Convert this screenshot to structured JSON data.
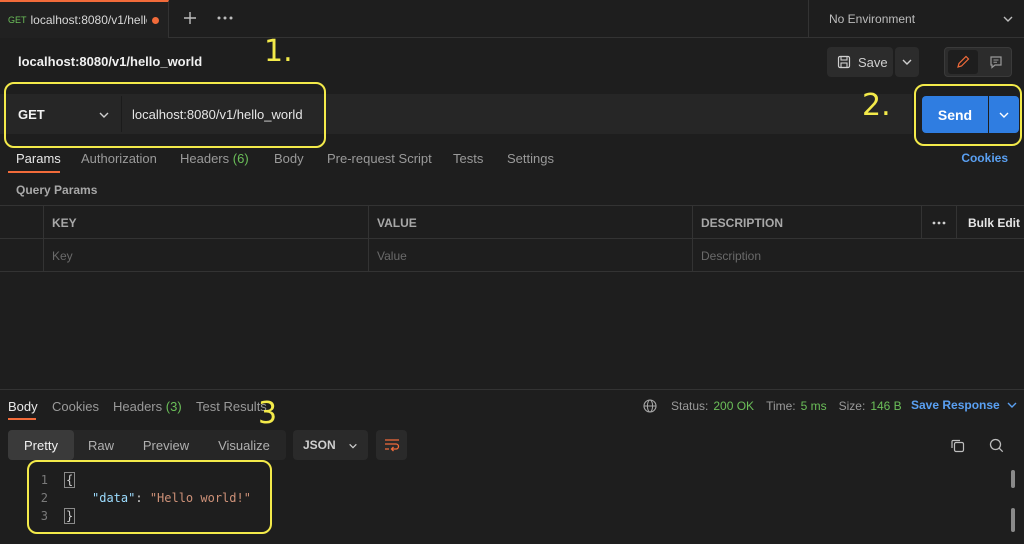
{
  "tab": {
    "method": "GET",
    "title": "localhost:8080/v1/hello"
  },
  "environment": {
    "label": "No Environment"
  },
  "request": {
    "title": "localhost:8080/v1/hello_world",
    "method": "GET",
    "url": "localhost:8080/v1/hello_world",
    "save_label": "Save",
    "send_label": "Send"
  },
  "request_tabs": {
    "params": "Params",
    "authorization": "Authorization",
    "headers": "Headers",
    "headers_count": "(6)",
    "body": "Body",
    "prerequest": "Pre-request Script",
    "tests": "Tests",
    "settings": "Settings",
    "cookies": "Cookies"
  },
  "query_params": {
    "title": "Query Params",
    "headers": {
      "key": "KEY",
      "value": "VALUE",
      "description": "DESCRIPTION"
    },
    "bulk_edit": "Bulk Edit",
    "placeholders": {
      "key": "Key",
      "value": "Value",
      "description": "Description"
    }
  },
  "response": {
    "tabs": {
      "body": "Body",
      "cookies": "Cookies",
      "headers": "Headers",
      "headers_count": "(3)",
      "test_results": "Test Results"
    },
    "status_label": "Status:",
    "status_value": "200 OK",
    "time_label": "Time:",
    "time_value": "5 ms",
    "size_label": "Size:",
    "size_value": "146 B",
    "save_response": "Save Response",
    "views": {
      "pretty": "Pretty",
      "raw": "Raw",
      "preview": "Preview",
      "visualize": "Visualize"
    },
    "format": "JSON",
    "lines": {
      "n1": "1",
      "n2": "2",
      "n3": "3",
      "l1": "{",
      "key": "\"data\"",
      "colon": ": ",
      "value": "\"Hello world!\"",
      "l3": "}"
    }
  },
  "annotations": {
    "one": "1.",
    "two": "2.",
    "three": "3"
  },
  "colors": {
    "accent": "#f26b3a",
    "send": "#2f7de1",
    "link": "#5aa0f2",
    "success": "#6bbf59",
    "annotation": "#f3ea4a"
  }
}
